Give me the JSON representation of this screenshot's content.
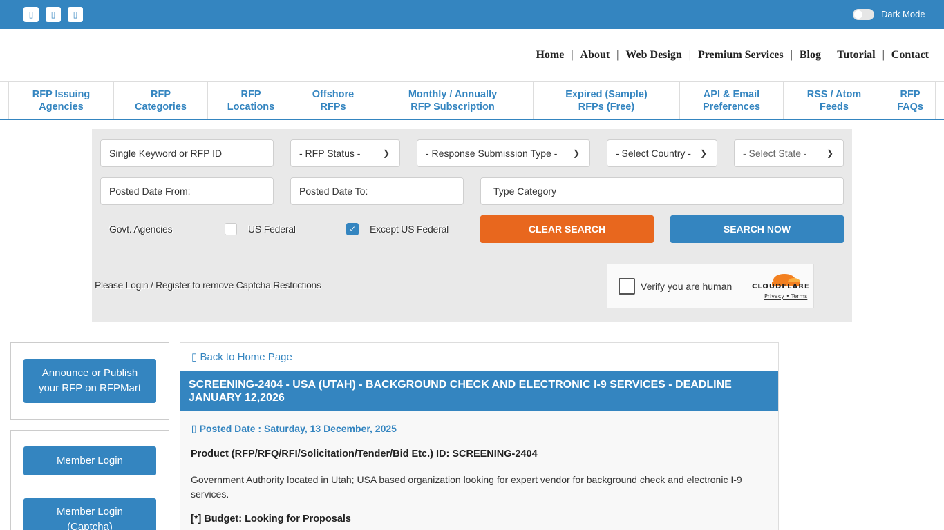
{
  "topbar": {
    "social_icons": [
      {
        "name": "facebook-icon",
        "glyph": "▯"
      },
      {
        "name": "twitter-icon",
        "glyph": "▯"
      },
      {
        "name": "linkedin-icon",
        "glyph": "▯"
      }
    ],
    "dark_mode_label": "Dark Mode",
    "dark_mode_on": false,
    "accent": "#3485c0"
  },
  "main_nav": [
    "Home",
    "About",
    "Web Design",
    "Premium Services",
    "Blog",
    "Tutorial",
    "Contact"
  ],
  "category_nav": [
    {
      "line1": "RFP Issuing",
      "line2": "Agencies"
    },
    {
      "line1": "RFP",
      "line2": "Categories"
    },
    {
      "line1": "RFP",
      "line2": "Locations"
    },
    {
      "line1": "Offshore",
      "line2": "RFPs"
    },
    {
      "line1": "Monthly / Annually",
      "line2": "RFP Subscription"
    },
    {
      "line1": "Expired (Sample)",
      "line2": "RFPs (Free)"
    },
    {
      "line1": "API & Email",
      "line2": "Preferences"
    },
    {
      "line1": "RSS / Atom",
      "line2": "Feeds"
    },
    {
      "line1": "RFP",
      "line2": "FAQs"
    }
  ],
  "search": {
    "keyword_placeholder": "Single Keyword or RFP ID",
    "rfp_status": "- RFP Status -",
    "response_type": "- Response Submission Type -",
    "country": "- Select Country -",
    "state": "- Select State -",
    "date_from_placeholder": "Posted Date From:",
    "date_to_placeholder": "Posted Date To:",
    "category_placeholder": "Type Category",
    "govt_label": "Govt. Agencies",
    "us_federal_label": "US Federal",
    "us_federal_checked": false,
    "except_us_federal_label": "Except US Federal",
    "except_us_federal_checked": true,
    "clear_button": "CLEAR SEARCH",
    "search_button": "SEARCH NOW",
    "captcha_message": "Please Login / Register to remove Captcha Restrictions",
    "captcha_widget": {
      "label": "Verify you are human",
      "brand": "CLOUDFLARE",
      "privacy": "Privacy",
      "terms": "Terms"
    }
  },
  "sidebar": {
    "announce_line1": "Announce or Publish",
    "announce_line2": "your RFP on RFPMart",
    "member_login": "Member Login",
    "member_login_captcha_line1": "Member Login",
    "member_login_captcha_line2": "(Captcha)"
  },
  "content": {
    "back_link": "Back to Home Page",
    "title": "SCREENING-2404 - USA (UTAH) - BACKGROUND CHECK AND ELECTRONIC I-9 SERVICES - DEADLINE JANUARY 12,2026",
    "posted_date": "Posted Date : Saturday, 13 December, 2025",
    "product_id": "Product (RFP/RFQ/RFI/Solicitation/Tender/Bid Etc.) ID: SCREENING-2404",
    "description": "Government Authority located in Utah; USA based organization looking for expert vendor for background check and electronic I-9 services.",
    "budget": "[*] Budget: Looking for Proposals"
  }
}
